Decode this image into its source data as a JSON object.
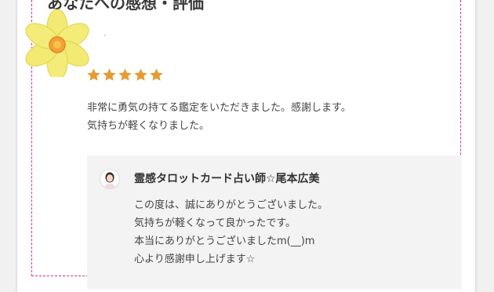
{
  "heading": "あなたへの感想・評価",
  "rating": {
    "value": 5,
    "max": 5,
    "color": "#e69b32"
  },
  "review": {
    "lines": [
      "非常に勇気の持てる鑑定をいただきました。感謝します。",
      "気持ちが軽くなりました。"
    ]
  },
  "reply": {
    "author": "霊感タロットカード占い師☆尾本広美",
    "lines": [
      "この度は、誠にありがとうございました。",
      "気持ちが軽くなって良かったです。",
      "本当にありがとうございましたm(__)m",
      "心より感謝申し上げます☆"
    ]
  },
  "colors": {
    "border": "#d0309a",
    "reply_bg": "#f3f3f3",
    "flower": "#f2e96a"
  },
  "icons": {
    "decoration": "daffodil-icon",
    "avatar": "avatar"
  }
}
